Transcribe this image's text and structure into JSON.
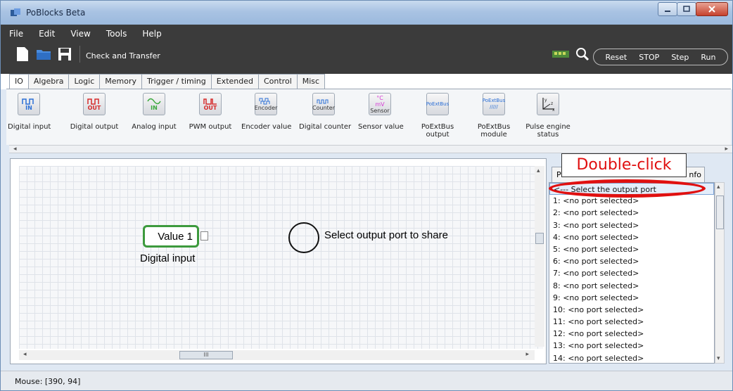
{
  "window": {
    "title": "PoBlocks Beta"
  },
  "menu": [
    "File",
    "Edit",
    "View",
    "Tools",
    "Help"
  ],
  "toolbar": {
    "check_transfer": "Check and Transfer"
  },
  "controls": [
    "Reset",
    "STOP",
    "Step",
    "Run"
  ],
  "tabs": [
    "IO",
    "Algebra",
    "Logic",
    "Memory",
    "Trigger / timing",
    "Extended",
    "Control",
    "Misc"
  ],
  "palette": [
    {
      "icon_text": "IN",
      "label": "Digital input",
      "color": "#2b6fd6"
    },
    {
      "icon_text": "OUT",
      "label": "Digital output",
      "color": "#d62b2b"
    },
    {
      "icon_text": "IN",
      "label": "Analog input",
      "color": "#39a83c"
    },
    {
      "icon_text": "OUT",
      "label": "PWM output",
      "color": "#d62b2b"
    },
    {
      "icon_text": "Encoder",
      "label": "Encoder value",
      "color": "#2b6fd6"
    },
    {
      "icon_text": "Counter",
      "label": "Digital counter",
      "color": "#2b6fd6"
    },
    {
      "icon_text": "Sensor",
      "label": "Sensor value",
      "color": "#d63bd6"
    },
    {
      "icon_text": "PoExtBus",
      "label": "PoExtBus output",
      "color": "#2b6fd6"
    },
    {
      "icon_text": "PoExtBus",
      "label": "PoExtBus module",
      "color": "#2b6fd6"
    },
    {
      "icon_text": "",
      "label": "Pulse engine status",
      "color": "#222"
    }
  ],
  "canvas": {
    "node_value": "Value 1",
    "node_caption": "Digital input",
    "hint_text": "Select output port to share"
  },
  "panel": {
    "tab_left": "P",
    "tab_right": "nfo",
    "items": [
      "<--- Select the output port",
      "1: <no port selected>",
      "2: <no port selected>",
      "3: <no port selected>",
      "4: <no port selected>",
      "5: <no port selected>",
      "6: <no port selected>",
      "7: <no port selected>",
      "8: <no port selected>",
      "9: <no port selected>",
      "10: <no port selected>",
      "11: <no port selected>",
      "12: <no port selected>",
      "13: <no port selected>",
      "14: <no port selected>"
    ]
  },
  "annotation": {
    "double_click": "Double-click"
  },
  "status": {
    "mouse": "Mouse: [390, 94]"
  }
}
